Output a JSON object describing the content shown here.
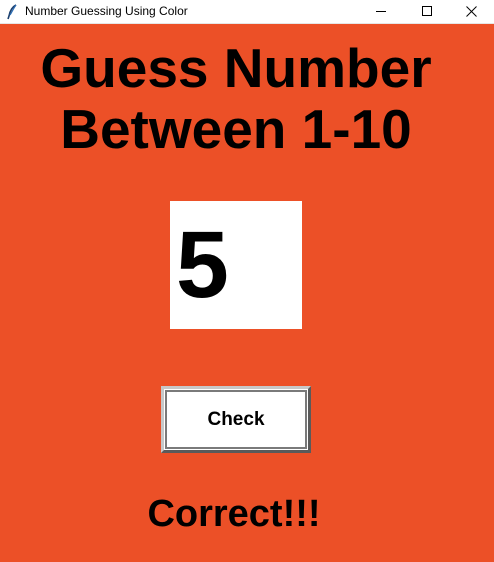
{
  "window": {
    "title": "Number Guessing Using Color",
    "controls": [
      "minimize",
      "maximize",
      "close"
    ]
  },
  "app": {
    "background_color": "#ec5027",
    "heading_line1": "Guess Number",
    "heading_line2": "Between 1-10",
    "guess_value": "5",
    "check_label": "Check",
    "result_text": "Correct!!!"
  },
  "icons": {
    "app_icon": "feather-icon",
    "minimize": "minimize-icon",
    "maximize": "maximize-icon",
    "close": "close-icon"
  }
}
